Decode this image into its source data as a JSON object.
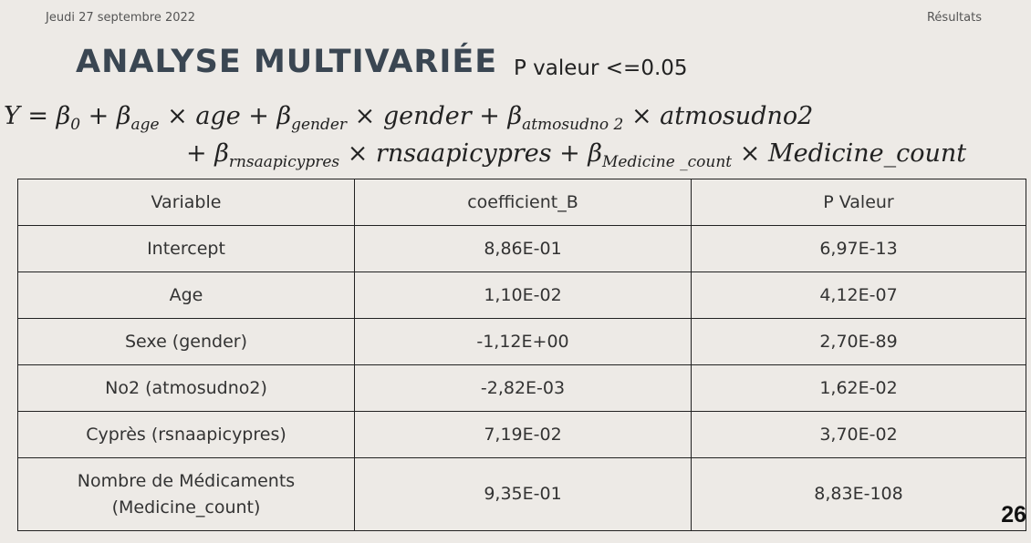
{
  "header": {
    "date": "Jeudi 27 septembre 2022",
    "section": "Résultats"
  },
  "title": "ANALYSE MULTIVARIÉE",
  "pvalue_note": "P valeur <=0.05",
  "equation": {
    "line1": {
      "y": "Y = ",
      "t1": "β",
      "s1": "0",
      "t2": " + β",
      "s2": "age",
      "t3": " × age + β",
      "s3": "gender",
      "t4": " × gender + β",
      "s4": "atmosudno 2",
      "t5": " × atmosudno2"
    },
    "line2": {
      "t1": "+ β",
      "s1": "rnsaapicypres",
      "t2": " × rnsaapicypres + β",
      "s2": "Medicine _count",
      "t3": " × Medicine_count"
    }
  },
  "table": {
    "headers": [
      "Variable",
      "coefficient_B",
      "P Valeur"
    ],
    "rows": [
      {
        "variable": "Intercept",
        "coef": "8,86E-01",
        "pval": "6,97E-13"
      },
      {
        "variable": "Age",
        "coef": "1,10E-02",
        "pval": "4,12E-07"
      },
      {
        "variable": "Sexe (gender)",
        "coef": "-1,12E+00",
        "pval": "2,70E-89"
      },
      {
        "variable": "No2 (atmosudno2)",
        "coef": "-2,82E-03",
        "pval": "1,62E-02"
      },
      {
        "variable": "Cyprès (rsnaapicypres)",
        "coef": "7,19E-02",
        "pval": "3,70E-02"
      },
      {
        "variable_line1": "Nombre de Médicaments",
        "variable_line2": "(Medicine_count)",
        "coef": "9,35E-01",
        "pval": "8,83E-108"
      }
    ]
  },
  "page_number": "26"
}
